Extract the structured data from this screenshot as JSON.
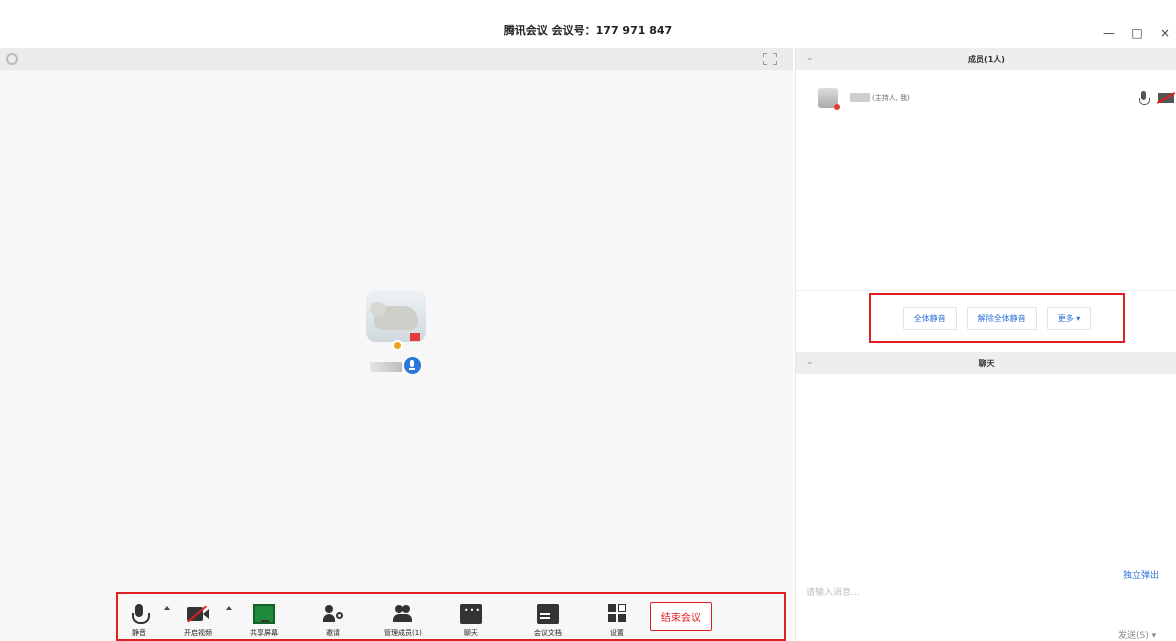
{
  "window": {
    "title": "腾讯会议 会议号：177 971 847",
    "minimize": "—",
    "maximize": "□",
    "close": "×"
  },
  "toolbar": {
    "mute_label": "静音",
    "video_label": "开启视频",
    "share_label": "共享屏幕",
    "invite_label": "邀请",
    "manage_members_label": "管理成员(1)",
    "chat_label": "聊天",
    "docs_label": "会议文档",
    "settings_label": "设置",
    "end_label": "结束会议"
  },
  "members_panel": {
    "title": "成员(1人)",
    "member_role": "(主持人, 我)",
    "mute_all": "全体静音",
    "unmute_all": "解除全体静音",
    "more": "更多 ▾"
  },
  "chat_panel": {
    "title": "聊天",
    "popout": "独立弹出",
    "input_placeholder": "请输入消息...",
    "send": "发送(S) ▾"
  },
  "colors": {
    "accent_red": "#e02020",
    "link_blue": "#2a6fd8",
    "share_green": "#1f8a3a"
  }
}
